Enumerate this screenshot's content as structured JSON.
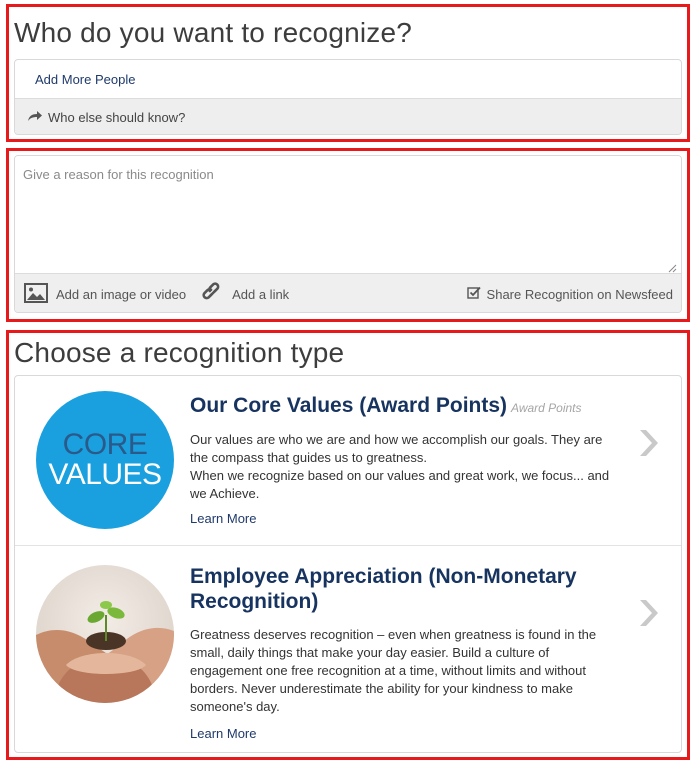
{
  "recipients": {
    "heading": "Who do you want to recognize?",
    "add_people_label": "Add More People",
    "notify_label": "Who else should know?",
    "notify_icon": "share-arrow-icon"
  },
  "reason": {
    "placeholder": "Give a reason for this recognition",
    "value": "",
    "add_image_label": "Add an image or video",
    "add_image_icon": "image-icon",
    "add_link_label": "Add a link",
    "add_link_icon": "link-icon",
    "share_label": "Share Recognition on Newsfeed",
    "share_checked": true
  },
  "types": {
    "heading": "Choose a recognition type",
    "items": [
      {
        "title": "Our Core Values (Award Points)",
        "subtitle": "Award Points",
        "image_text_top": "CORE",
        "image_text_bottom": "VALUES",
        "description_line1": "Our values are who we are and how we accomplish our goals. They are the compass that guides us to greatness.",
        "description_line2": "When we recognize based on our values and great work, we focus... and we Achieve.",
        "learn_more": "Learn More"
      },
      {
        "title": "Employee Appreciation (Non-Monetary Recognition)",
        "subtitle": "",
        "image_alt": "hands holding seedling",
        "description_line1": "Greatness deserves recognition – even when greatness is found in the small, daily things that make your day easier. Build a culture of engagement one free recognition at a time, without limits and without borders. Never underestimate the ability for your kindness to make someone's day.",
        "learn_more": "Learn More"
      }
    ]
  },
  "colors": {
    "highlight_border": "#e8191b",
    "title_navy": "#17335f",
    "link_navy": "#1f3a6b",
    "core_blue": "#1aa0df"
  }
}
